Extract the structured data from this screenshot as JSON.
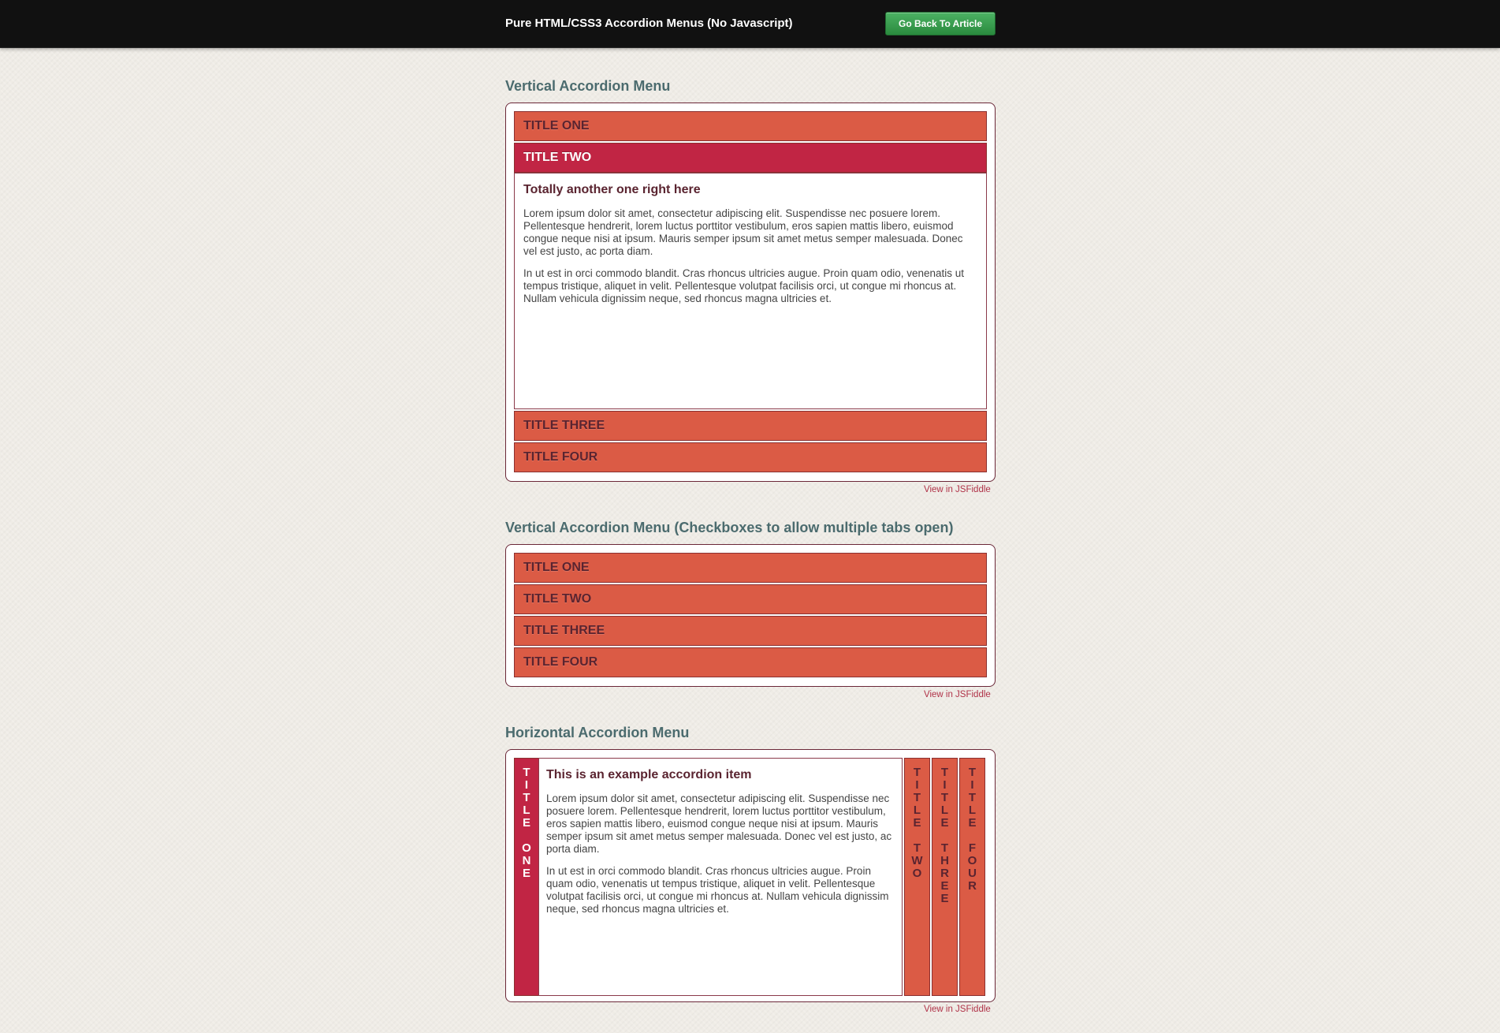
{
  "header": {
    "title": "Pure HTML/CSS3 Accordion Menus (No Javascript)",
    "back_button": "Go Back To Article"
  },
  "section1": {
    "title": "Vertical Accordion Menu",
    "tabs": [
      "TITLE ONE",
      "TITLE TWO",
      "TITLE THREE",
      "TITLE FOUR"
    ],
    "active_tab": "TITLE TWO",
    "content_heading": "Totally another one right here",
    "content_p1": "Lorem ipsum dolor sit amet, consectetur adipiscing elit. Suspendisse nec posuere lorem. Pellentesque hendrerit, lorem luctus porttitor vestibulum, eros sapien mattis libero, euismod congue neque nisi at ipsum. Mauris semper ipsum sit amet metus semper malesuada. Donec vel est justo, ac porta diam.",
    "content_p2": "In ut est in orci commodo blandit. Cras rhoncus ultricies augue. Proin quam odio, venenatis ut tempus tristique, aliquet in velit. Pellentesque volutpat facilisis orci, ut congue mi rhoncus at. Nullam vehicula dignissim neque, sed rhoncus magna ultricies et.",
    "link": "View in JSFiddle"
  },
  "section2": {
    "title": "Vertical Accordion Menu (Checkboxes to allow multiple tabs open)",
    "tabs": [
      "TITLE ONE",
      "TITLE TWO",
      "TITLE THREE",
      "TITLE FOUR"
    ],
    "link": "View in JSFiddle"
  },
  "section3": {
    "title": "Horizontal Accordion Menu",
    "tabs": [
      "TITLE ONE",
      "TITLE TWO",
      "TITLE THREE",
      "TITLE FOUR"
    ],
    "active_tab": "TITLE ONE",
    "content_heading": "This is an example accordion item",
    "content_p1": "Lorem ipsum dolor sit amet, consectetur adipiscing elit. Suspendisse nec posuere lorem. Pellentesque hendrerit, lorem luctus porttitor vestibulum, eros sapien mattis libero, euismod congue neque nisi at ipsum. Mauris semper ipsum sit amet metus semper malesuada. Donec vel est justo, ac porta diam.",
    "content_p2": "In ut est in orci commodo blandit. Cras rhoncus ultricies augue. Proin quam odio, venenatis ut tempus tristique, aliquet in velit. Pellentesque volutpat facilisis orci, ut congue mi rhoncus at. Nullam vehicula dignissim neque, sed rhoncus magna ultricies et.",
    "link": "View in JSFiddle"
  },
  "colors": {
    "tab_inactive": "#db5b45",
    "tab_active": "#c12544",
    "heading": "#4b6b6e",
    "link": "#b03248",
    "topbar": "#111111",
    "button": "#3a9e50"
  }
}
